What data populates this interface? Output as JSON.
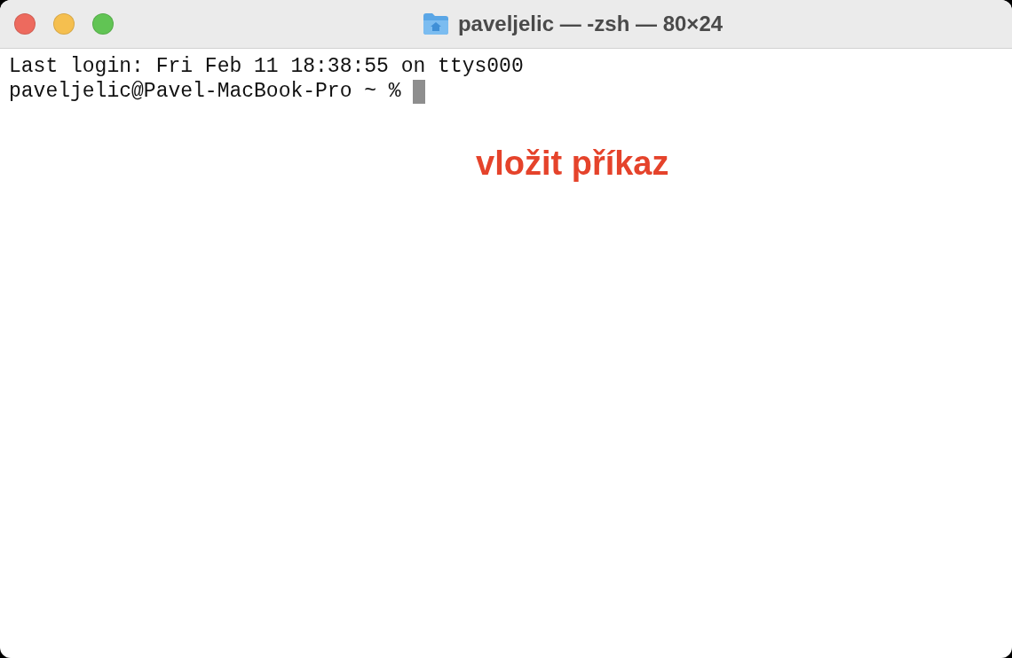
{
  "window": {
    "title": "paveljelic — -zsh — 80×24"
  },
  "terminal": {
    "lines": [
      "Last login: Fri Feb 11 18:38:55 on ttys000"
    ],
    "prompt": "paveljelic@Pavel-MacBook-Pro ~ % ",
    "cursor": true
  },
  "annotation": {
    "text": "vložit příkaz",
    "color": "#e5432b"
  }
}
